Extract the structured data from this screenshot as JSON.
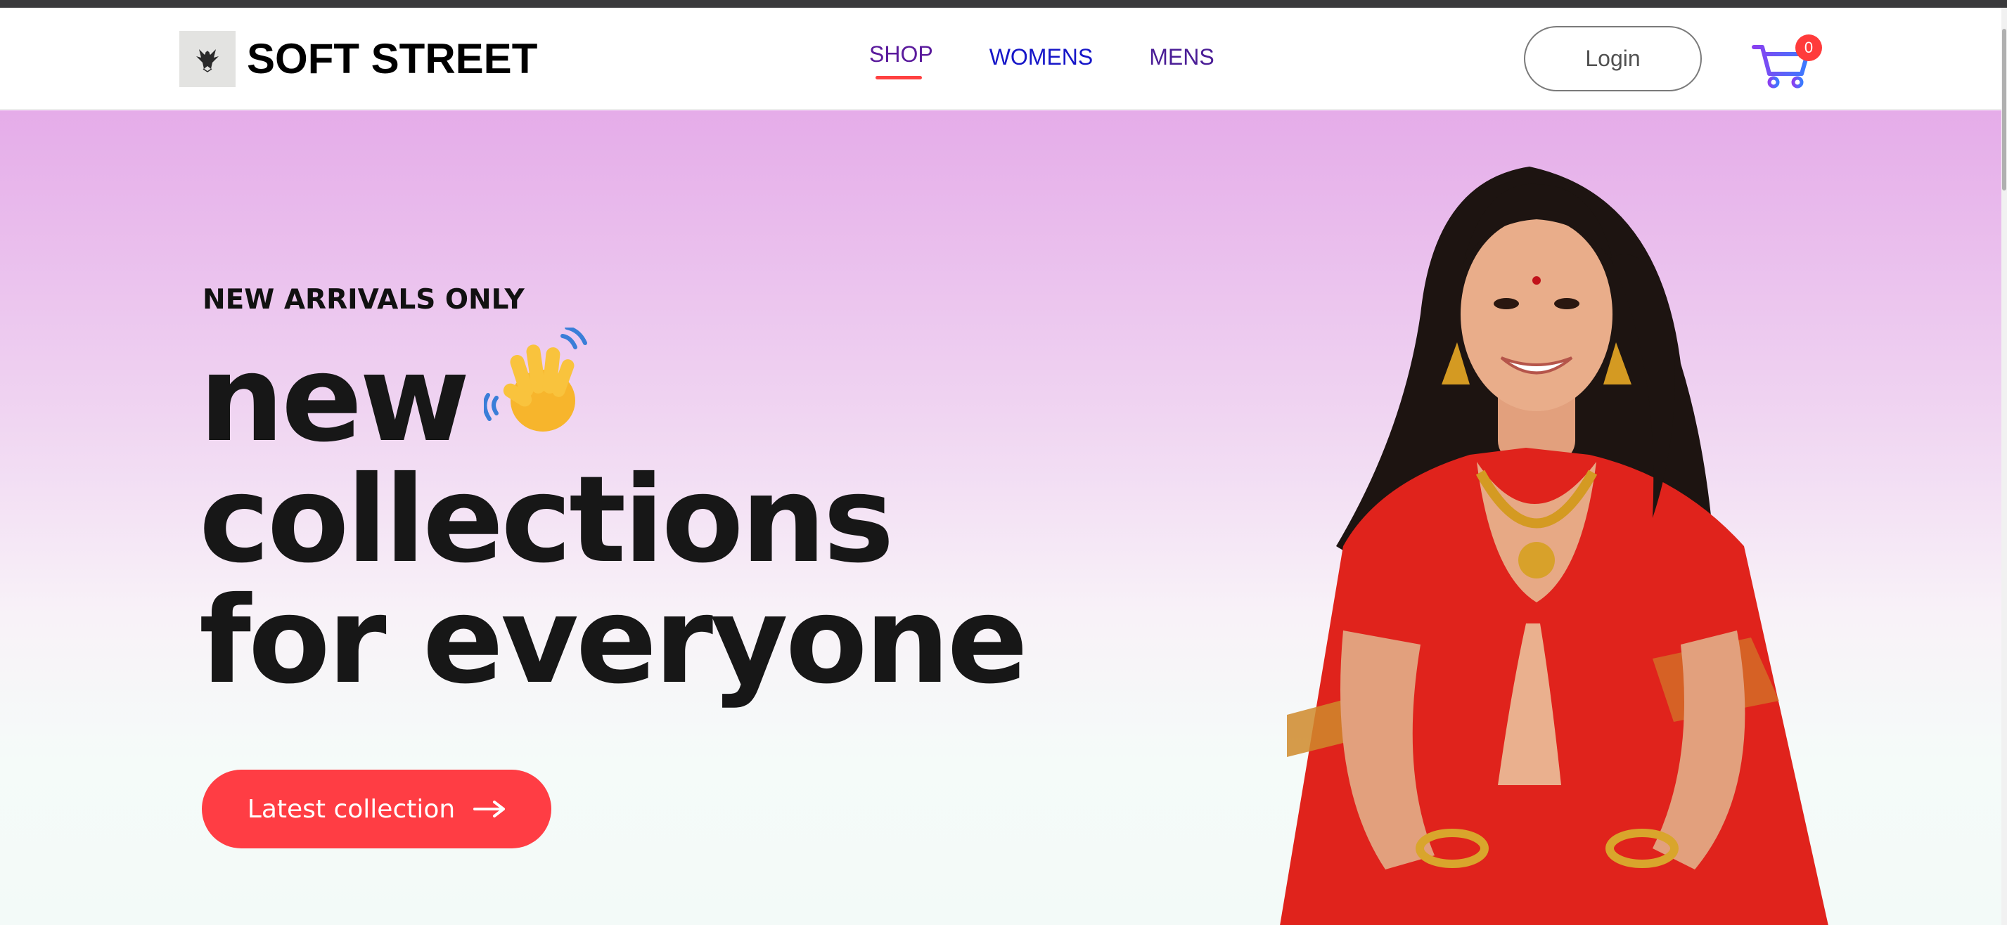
{
  "brand": {
    "logo_icon": "eagle-emblem-icon",
    "name": "SOFT STREET"
  },
  "nav": {
    "items": [
      {
        "label": "SHOP",
        "active": true,
        "color": "#5a1a9c"
      },
      {
        "label": "WOMENS",
        "active": false,
        "color": "#1616c8"
      },
      {
        "label": "MENS",
        "active": false,
        "color": "#4a1d96"
      }
    ],
    "active_indicator_color": "#ff4141"
  },
  "header_actions": {
    "login_label": "Login",
    "cart_icon": "shopping-cart-icon",
    "cart_count": "0"
  },
  "hero": {
    "eyebrow": "NEW ARRIVALS ONLY",
    "headline_line1": "new",
    "headline_line2": "collections",
    "headline_line3": "for everyone",
    "wave_icon": "waving-hand-icon",
    "cta_label": "Latest collection",
    "cta_icon": "arrow-right-icon",
    "cta_color": "#ff3d44",
    "image": "woman-in-red-saree-namaste"
  }
}
